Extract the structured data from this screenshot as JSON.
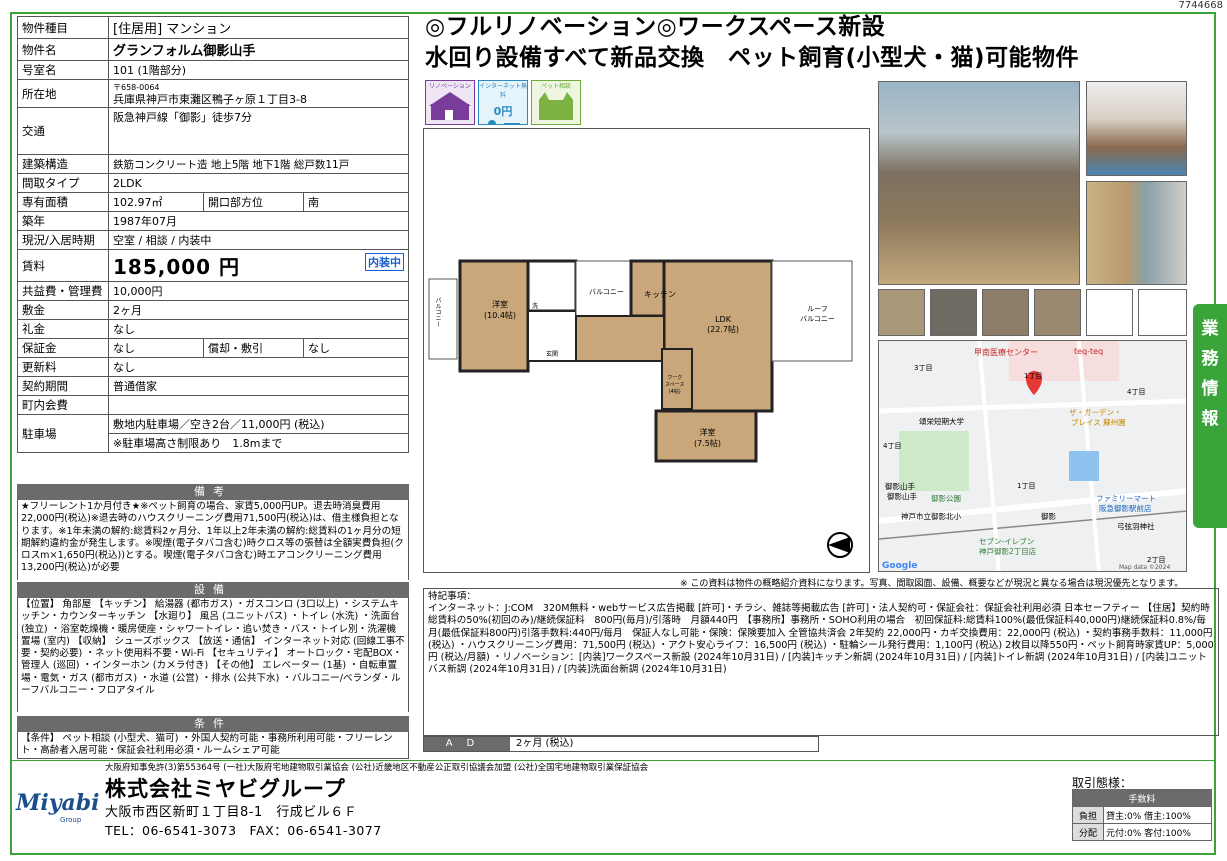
{
  "doc_id": "7744668",
  "info_rows": {
    "type_label": "物件種目",
    "type_value": "[住居用] マンション",
    "name_label": "物件名",
    "name_value": "グランフォルム御影山手",
    "room_label": "号室名",
    "room_value": "101 (1階部分)",
    "addr_label": "所在地",
    "addr_zip": "〒658-0064",
    "addr_value": "兵庫県神戸市東灘区鴨子ヶ原１丁目3-8",
    "access_label": "交通",
    "access_value": "阪急神戸線「御影」徒歩7分",
    "structure_label": "建築構造",
    "structure_value": "鉄筋コンクリート造 地上5階 地下1階 総戸数11戸",
    "layout_label": "間取タイプ",
    "layout_value": "2LDK",
    "area_label": "専有面積",
    "area_value": "102.97㎡",
    "opening_label": "開口部方位",
    "opening_value": "南",
    "built_label": "築年",
    "built_value": "1987年07月",
    "status_label": "現況/入居時期",
    "status_value": "空室 / 相談 / 内装中",
    "rent_label": "賃料",
    "rent_value": "185,000 円",
    "rent_badge": "内装中",
    "fee_label": "共益費・管理費",
    "fee_value": "10,000円",
    "deposit_label": "敷金",
    "deposit_value": "2ヶ月",
    "key_label": "礼金",
    "key_value": "なし",
    "guarantee_label": "保証金",
    "guarantee_value": "なし",
    "amort_label": "償却・敷引",
    "amort_value": "なし",
    "renewal_label": "更新料",
    "renewal_value": "なし",
    "contract_label": "契約期間",
    "contract_value": "普通借家",
    "town_label": "町内会費",
    "town_value": "",
    "parking_label": "駐車場",
    "parking_value": "敷地内駐車場／空き2台／11,000円 (税込)",
    "parking_note": "※駐車場高さ制限あり　1.8mまで"
  },
  "remarks": {
    "header": "備考",
    "text": "★フリーレント1か月付き★※ペット飼育の場合、家賃5,000円UP。退去時消臭費用22,000円(税込)※退去時のハウスクリーニング費用71,500円(税込)は、借主様負担となります。※1年未満の解約:総賃料2ヶ月分、1年以上2年未満の解約:総賃料の1ヶ月分の短期解約違約金が発生します。※喫煙(電子タバコ含む)時クロス等の張替は全額実費負担(クロスm×1,650円(税込))とする。喫煙(電子タバコ含む)時エアコンクリーニング費用13,200円(税込)が必要"
  },
  "equipment": {
    "header": "設備",
    "text": "【位置】 角部屋 【キッチン】 給湯器 (都市ガス) ・ガスコンロ (3口以上) ・システムキッチン・カウンターキッチン 【水廻り】 風呂 (ユニットバス) ・トイレ (水洗) ・洗面台 (独立) ・浴室乾燥機・暖房便座・シャワートイレ・追い焚き・バス・トイレ別・洗濯機置場 (室内) 【収納】 シューズボックス 【放送・通信】 インターネット対応 (回線工事不要・契約必要) ・ネット使用料不要・Wi-Fi 【セキュリティ】 オートロック・宅配BOX・管理人 (巡回) ・インターホン (カメラ付き) 【その他】 エレベーター (1基) ・自転車置場・電気・ガス (都市ガス) ・水道 (公営) ・排水 (公共下水) ・バルコニー/ベランダ・ルーフバルコニー・フロアタイル"
  },
  "conditions": {
    "header": "条件",
    "text": "【条件】 ペット相談 (小型犬、猫可) ・外国人契約可能・事務所利用可能・フリーレント・高齢者入居可能・保証会社利用必須・ルームシェア可能"
  },
  "headline": {
    "line1": "◎フルリノベーション◎ワークスペース新設",
    "line2": "水回り設備すべて新品交換　ペット飼育(小型犬・猫)可能物件"
  },
  "icons": [
    {
      "name": "renovation-icon",
      "label": "リノベーション"
    },
    {
      "name": "internet-free-icon",
      "label": "インターネット無料",
      "sub": "0円"
    },
    {
      "name": "pet-ok-icon",
      "label": "ペット相談"
    }
  ],
  "floorplan": {
    "room_west": "洋室",
    "room_west_size": "(10.4帖)",
    "ldk": "LDK",
    "ldk_size": "(22.7帖)",
    "room_south": "洋室",
    "room_south_size": "(7.5帖)",
    "kitchen": "キッチン",
    "balcony": "バルコニー",
    "roof": "ルーフ",
    "roof2": "バルコニー",
    "work": "ワーク",
    "work2": "スペース",
    "work3": "(4帖)",
    "wash": "洗",
    "ent": "玄関",
    "left_balcony": "バルコニー"
  },
  "map": {
    "label_hospital": "甲南医療センター",
    "label_teq": "teq-teq",
    "label_3": "3丁目",
    "label_1": "1丁目",
    "label_4": "4丁目",
    "label_4b": "4丁目",
    "label_college": "頌栄短期大学",
    "label_garden": "ザ・ガーデン・",
    "label_garden2": "プレイス 蘇州園",
    "label_mikage": "御影山手",
    "label_park": "御影公園",
    "label_fm": "ファミリーマート",
    "label_fm2": "阪急御影駅前店",
    "label_kita": "神戸市立御影北小",
    "label_mikage_st": "御影",
    "label_yumi": "弓弦羽神社",
    "label_711": "セブン-イレブン",
    "label_7112": "神戸御影2丁目店",
    "label_2": "2丁目",
    "label_google": "Google",
    "label_mapdata": "Map data ©2024",
    "label_1b": "1丁目",
    "label_st": "御影山手"
  },
  "side_tab": [
    "業",
    "務",
    "情",
    "報"
  ],
  "disclaimer": "※ この資料は物件の概略紹介資料になります。写真、間取図面、設備、概要などが現況と異なる場合は現況優先となります。",
  "special": {
    "text": "特記事項：\nインターネット：J:COM　320M無料・webサービス広告掲載 [許可]・チラシ、雑誌等掲載広告 [許可]・法人契約可・保証会社：保証会社利用必須 日本セーフティー 【住居】契約時　総賃料の50%(初回のみ)/継続保証料　800円(毎月)/引落時　月額440円　【事務所】事務所・SOHO利用の場合　初回保証料:総賃料100%(最低保証料40,000円)継続保証料0.8%/毎月(最低保証料800円)引落手数料:440円/毎月　保証人なし可能・保険：保険要加入 全管協共済会 2年契約 22,000円・カギ交換費用：22,000円 (税込) ・契約事務手数料：11,000円 (税込) ・ハウスクリーニング費用：71,500円 (税込) ・アクト安心ライフ：16,500円 (税込) ・駐輪シール発行費用：1,100円 (税込) 2枚目以降550円・ペット飼育時家賃UP：5,000円 (税込/月額) ・リノベーション：[内装]ワークスペース新設 (2024年10月31日) / [内装]キッチン新調 (2024年10月31日) / [内装]トイレ新調 (2024年10月31日) / [内装]ユニットバス新調 (2024年10月31日) / [内装]洗面台新調 (2024年10月31日)"
  },
  "ad": {
    "label": "AD",
    "value": "2ヶ月 (税込)"
  },
  "footer": {
    "license": "大阪府知事免許(3)第55364号 (一社)大阪府宅地建物取引業協会 (公社)近畿地区不動産公正取引協議会加盟 (公社)全国宅地建物取引業保証協会",
    "company": "株式会社ミヤビグループ",
    "address": "大阪市西区新町１丁目8-1　行成ビル６Ｆ",
    "tel": "TEL：06-6541-3073　FAX：06-6541-3077",
    "logo_text": "Miyabi",
    "logo_sub": "Group",
    "torihiki": "取引態様：",
    "fee_header": "手数料",
    "fee_row1_label": "負担",
    "fee_row1_value": "貸主:0% 借主:100%",
    "fee_row2_label": "分配",
    "fee_row2_value": "元付:0% 客付:100%"
  },
  "colors": {
    "accent": "#3aa43a",
    "header_gray": "#6b6b6b",
    "badge_blue": "#1a5fd0"
  }
}
